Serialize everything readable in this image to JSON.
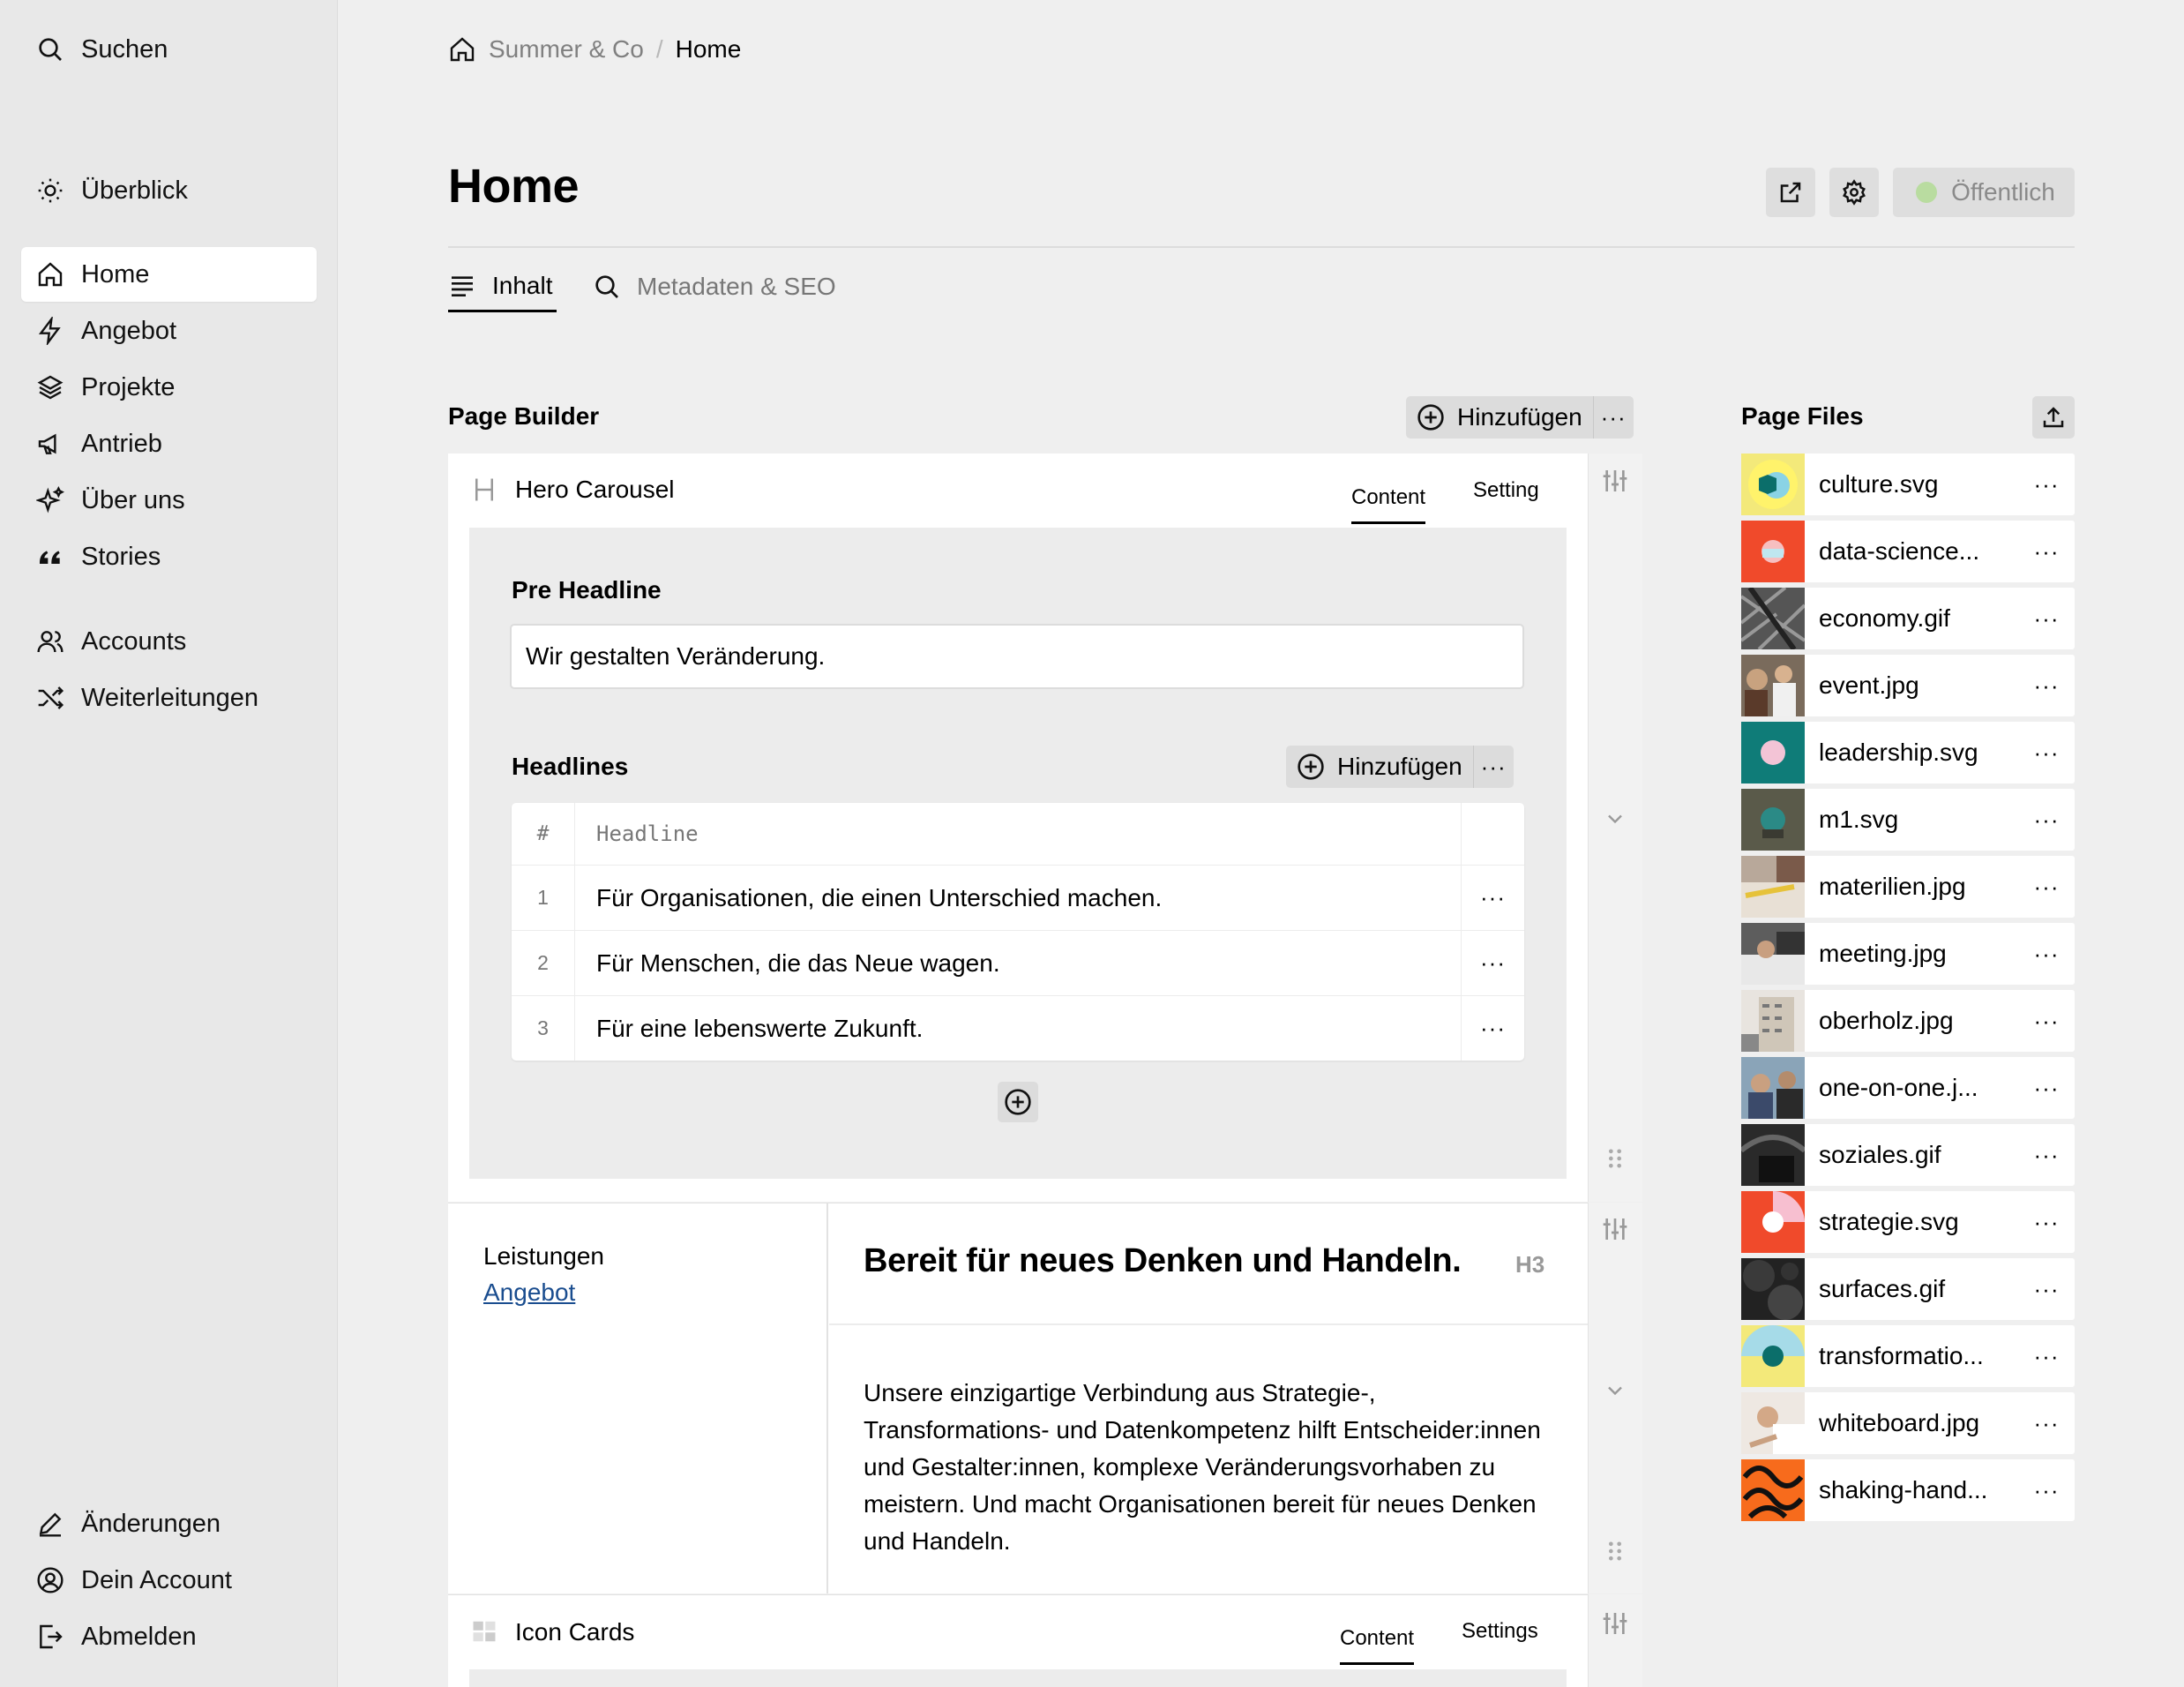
{
  "sidebar": {
    "search": "Suchen",
    "overview": "Überblick",
    "nav": [
      {
        "label": "Home",
        "icon": "home-icon",
        "active": true
      },
      {
        "label": "Angebot",
        "icon": "bolt-icon"
      },
      {
        "label": "Projekte",
        "icon": "layers-icon"
      },
      {
        "label": "Antrieb",
        "icon": "megaphone-icon"
      },
      {
        "label": "Über uns",
        "icon": "sparkles-icon"
      },
      {
        "label": "Stories",
        "icon": "quote-icon"
      }
    ],
    "accounts": "Accounts",
    "redirects": "Weiterleitungen",
    "changes": "Änderungen",
    "my_account": "Dein Account",
    "logout": "Abmelden"
  },
  "breadcrumb": {
    "site": "Summer & Co",
    "separator": "/",
    "current": "Home"
  },
  "page": {
    "title": "Home",
    "status": "Öffentlich",
    "status_color": "#b9dca0"
  },
  "tabs": {
    "content": "Inhalt",
    "seo": "Metadaten & SEO"
  },
  "builder": {
    "title": "Page Builder",
    "add_label": "Hinzufügen",
    "more": "···",
    "hero": {
      "name": "Hero Carousel",
      "tab_content": "Content",
      "tab_setting": "Setting",
      "pre_headline_label": "Pre Headline",
      "pre_headline_value": "Wir gestalten Veränderung.",
      "headlines_label": "Headlines",
      "add_label": "Hinzufügen",
      "col_num": "#",
      "col_headline": "Headline",
      "rows": [
        {
          "num": "1",
          "text": "Für Organisationen, die einen Unterschied machen."
        },
        {
          "num": "2",
          "text": "Für Menschen, die das Neue wagen."
        },
        {
          "num": "3",
          "text": "Für eine lebenswerte Zukunft."
        }
      ]
    },
    "text_block": {
      "kicker": "Leistungen",
      "link": "Angebot",
      "heading": "Bereit für neues Denken und Handeln.",
      "level": "H3",
      "body": "Unsere einzigartige Verbindung aus Strategie-, Transformations- und Datenkompetenz hilft Entscheider:innen und Gestalter:innen, komplexe Veränderungsvorhaben zu meistern. Und macht Organisationen bereit für neues Denken und Handeln."
    },
    "icon_cards": {
      "name": "Icon Cards",
      "tab_content": "Content",
      "tab_settings": "Settings"
    }
  },
  "files": {
    "title": "Page Files",
    "items": [
      {
        "name": "culture.svg"
      },
      {
        "name": "data-science..."
      },
      {
        "name": "economy.gif"
      },
      {
        "name": "event.jpg"
      },
      {
        "name": "leadership.svg"
      },
      {
        "name": "m1.svg"
      },
      {
        "name": "materilien.jpg"
      },
      {
        "name": "meeting.jpg"
      },
      {
        "name": "oberholz.jpg"
      },
      {
        "name": "one-on-one.j..."
      },
      {
        "name": "soziales.gif"
      },
      {
        "name": "strategie.svg"
      },
      {
        "name": "surfaces.gif"
      },
      {
        "name": "transformatio..."
      },
      {
        "name": "whiteboard.jpg"
      },
      {
        "name": "shaking-hand..."
      }
    ]
  }
}
